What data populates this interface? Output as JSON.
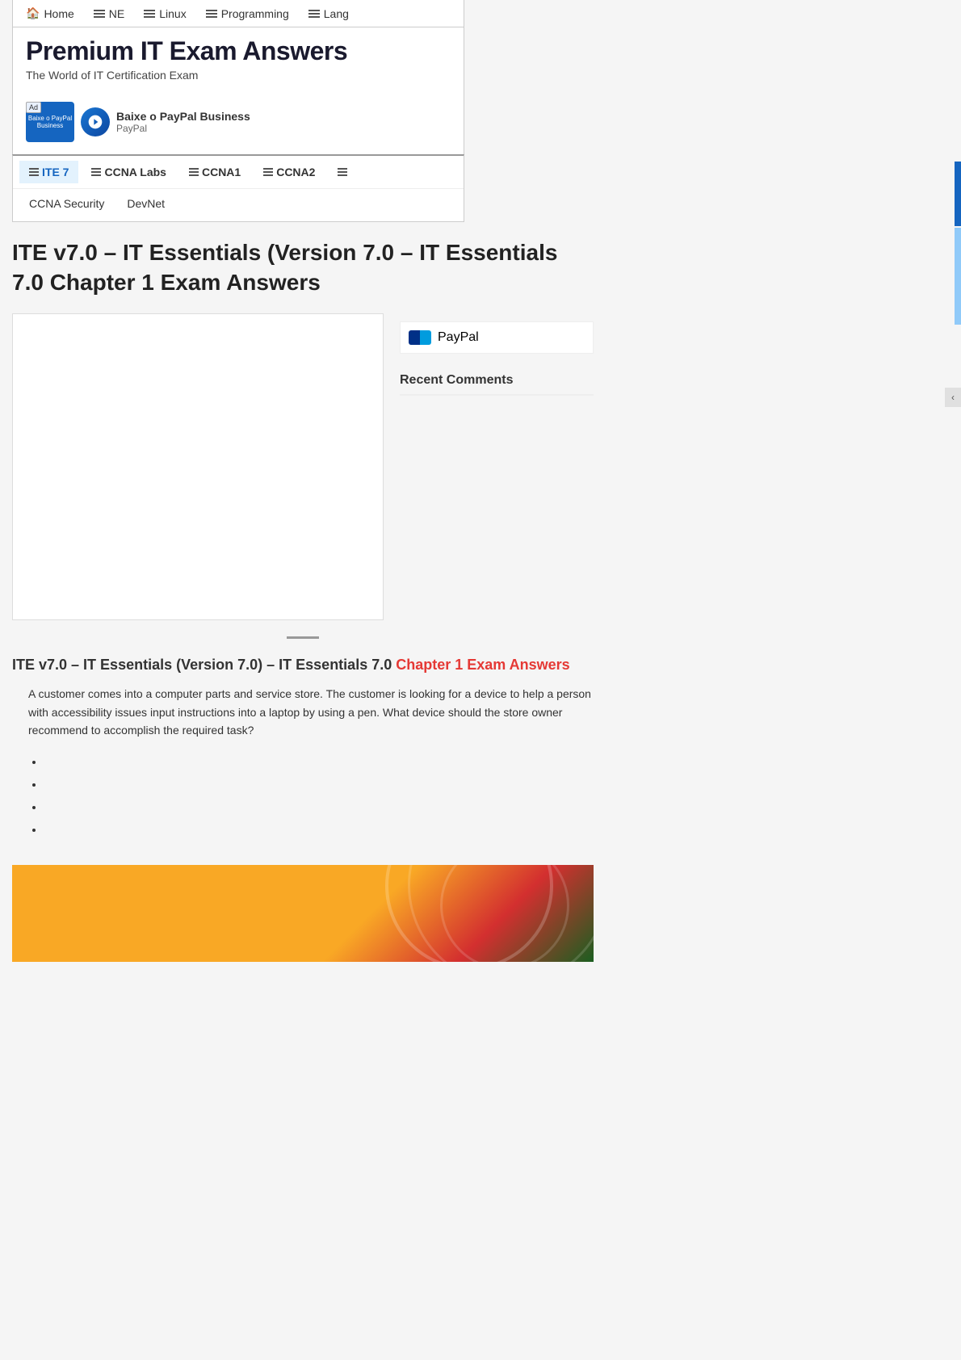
{
  "site": {
    "title": "Premium IT Exam Answers",
    "subtitle": "The World of IT Certification Exam"
  },
  "topNav": {
    "items": [
      {
        "label": "Home",
        "icon": "home"
      },
      {
        "label": "NE",
        "icon": "menu"
      },
      {
        "label": "Linux",
        "icon": "menu"
      },
      {
        "label": "Programming",
        "icon": "menu"
      },
      {
        "label": "Lang",
        "icon": "menu"
      }
    ]
  },
  "subNav": {
    "row1": [
      {
        "label": "ITE 7",
        "icon": "menu",
        "active": true
      },
      {
        "label": "CCNA Labs",
        "icon": "menu"
      },
      {
        "label": "CCNA1",
        "icon": "menu"
      },
      {
        "label": "CCNA2",
        "icon": "menu"
      },
      {
        "label": "...",
        "icon": "menu"
      }
    ],
    "row2": [
      {
        "label": "CCNA Security"
      },
      {
        "label": "DevNet"
      }
    ]
  },
  "ad": {
    "badge": "Ad",
    "label": "Baixe o PayPal Business",
    "title": "Baixe o PayPal Business",
    "subtitle": "PayPal"
  },
  "pageTitle": "ITE v7.0 – IT Essentials (Version 7.0 – IT Essentials 7.0 Chapter 1 Exam Answers",
  "sidebar": {
    "paypalLabel": "PayPal",
    "recentComments": "Recent Comments"
  },
  "articleSubtitle": "ITE v7.0 – IT Essentials (Version 7.0) – IT Essentials 7.0",
  "articleHighlight": "Chapter 1 Exam Answers",
  "questionText": "A customer comes into a computer parts and service store. The customer is looking for a device to help a person with accessibility issues input instructions into a laptop by using a pen. What device should the store owner recommend to accomplish the required task?",
  "answers": [
    "",
    "",
    "",
    ""
  ],
  "colors": {
    "primary": "#1565c0",
    "accent": "#e53935",
    "light": "#90caf9"
  }
}
